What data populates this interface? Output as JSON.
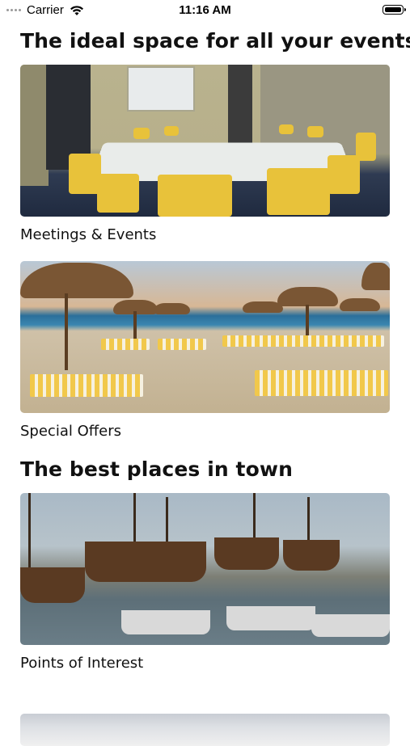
{
  "status_bar": {
    "carrier": "Carrier",
    "time": "11:16 AM"
  },
  "sections": [
    {
      "title": "The ideal space for all your events",
      "cards": [
        {
          "label": "Meetings & Events",
          "image": "meeting-room-photo"
        },
        {
          "label": "Special Offers",
          "image": "beach-umbrellas-photo"
        }
      ]
    },
    {
      "title": "The best places in town",
      "cards": [
        {
          "label": "Points of Interest",
          "image": "harbor-boats-photo"
        }
      ]
    }
  ],
  "colors": {
    "background": "#ffffff",
    "text": "#111111"
  }
}
